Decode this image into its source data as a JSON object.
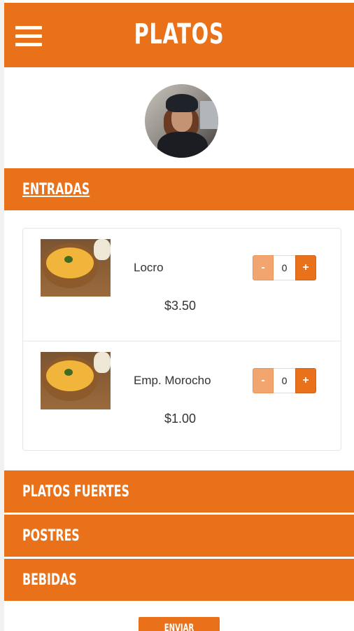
{
  "header": {
    "title": "PLATOS",
    "menu_icon": "hamburger-menu-icon"
  },
  "profile": {
    "avatar": "user-avatar"
  },
  "sections": [
    {
      "label": "ENTRADAS",
      "expanded": true
    },
    {
      "label": "PLATOS FUERTES",
      "expanded": false
    },
    {
      "label": "POSTRES",
      "expanded": false
    },
    {
      "label": "BEBIDAS",
      "expanded": false
    }
  ],
  "entradas": {
    "items": [
      {
        "name": "Locro",
        "price": "$3.50",
        "quantity": "0",
        "minus_label": "-",
        "plus_label": "+"
      },
      {
        "name": "Emp. Morocho",
        "price": "$1.00",
        "quantity": "0",
        "minus_label": "-",
        "plus_label": "+"
      }
    ]
  },
  "footer": {
    "send_label": "ENVIAR ORDEN"
  },
  "colors": {
    "accent": "#e8711a",
    "accent_light": "#f2a56f",
    "text": "#333333"
  }
}
